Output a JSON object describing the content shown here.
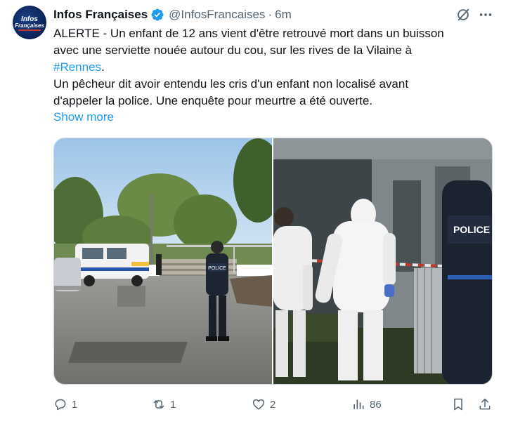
{
  "tweet": {
    "author": {
      "avatar_text_line1": "Infos",
      "avatar_text_line2": "Françaises",
      "name": "Infos Françaises",
      "handle": "@InfosFrancaises",
      "separator": "·",
      "time": "6m",
      "verified_icon": "verified-badge-icon"
    },
    "text": {
      "line1": "ALERTE - Un enfant de 12 ans vient d'être retrouvé mort dans un buisson",
      "line2": "avec une serviette nouée autour du cou, sur les rives de la Vilaine à",
      "hashtag": "#Rennes",
      "after_hashtag": ".",
      "line4": "Un pêcheur dit avoir entendu les cris d'un enfant non localisé avant",
      "line5": "d'appeler la police. Une enquête pour meurtre a été ouverte."
    },
    "show_more": "Show more",
    "media": {
      "left_photo_vest_text": "POLICE",
      "right_photo_vest_text": "POLICE"
    },
    "actions": {
      "replies": "1",
      "reposts": "1",
      "likes": "2",
      "views": "86"
    },
    "colors": {
      "accent": "#1d9bf0",
      "muted": "#536471",
      "text": "#0f1419"
    }
  }
}
